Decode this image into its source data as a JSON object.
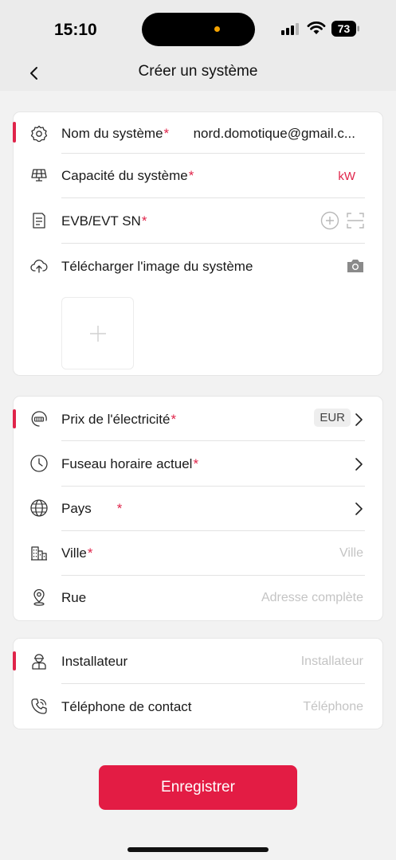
{
  "status_bar": {
    "time": "15:10",
    "battery": "73"
  },
  "navbar": {
    "title": "Créer un système"
  },
  "system_card": {
    "name": {
      "label": "Nom du système",
      "required_mark": "*",
      "value": "nord.domotique@gmail.c..."
    },
    "capacity": {
      "label": "Capacité du système",
      "required_mark": "*",
      "unit": "kW"
    },
    "evb_sn": {
      "label": "EVB/EVT SN",
      "required_mark": "*"
    },
    "image": {
      "label": "Télécharger l'image du système"
    }
  },
  "location_card": {
    "price": {
      "label": "Prix de l'électricité",
      "required_mark": "*",
      "currency": "EUR"
    },
    "timezone": {
      "label": "Fuseau horaire actuel",
      "required_mark": "*"
    },
    "country": {
      "label": "Pays",
      "required_mark": "*"
    },
    "city": {
      "label": "Ville",
      "required_mark": "*",
      "placeholder": "Ville"
    },
    "street": {
      "label": "Rue",
      "placeholder": "Adresse complète"
    }
  },
  "contact_card": {
    "installer": {
      "label": "Installateur",
      "placeholder": "Installateur"
    },
    "phone": {
      "label": "Téléphone de contact",
      "placeholder": "Téléphone"
    }
  },
  "save_button": {
    "label": "Enregistrer"
  },
  "colors": {
    "accent": "#e0244a",
    "button": "#e31c44",
    "header_bg": "#ebebeb"
  },
  "icons": [
    "gear-icon",
    "solar-panel-icon",
    "document-icon",
    "cloud-upload-icon",
    "camera-icon",
    "plus-circle-icon",
    "scan-icon",
    "meter-icon",
    "clock-icon",
    "globe-icon",
    "building-icon",
    "location-pin-icon",
    "installer-icon",
    "phone-icon",
    "chevron-right-icon",
    "back-icon"
  ]
}
